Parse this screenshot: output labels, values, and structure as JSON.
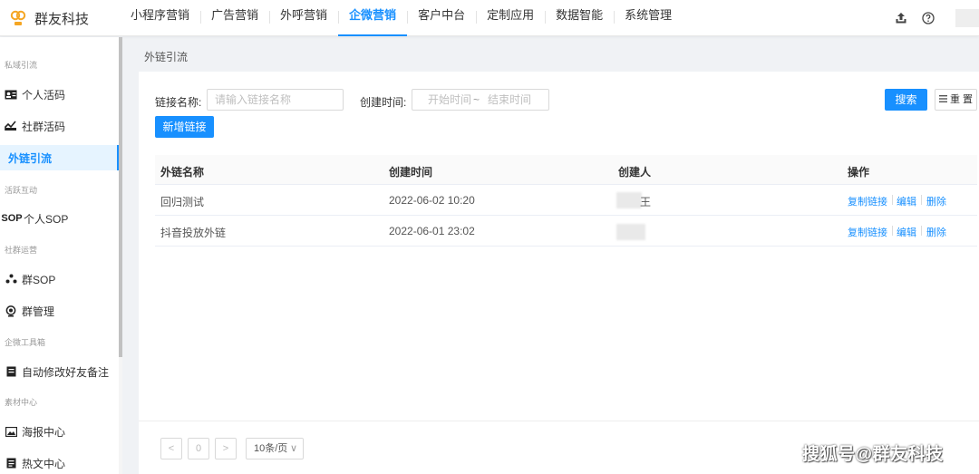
{
  "app": {
    "logo_text": "群友科技"
  },
  "nav": {
    "items": [
      "小程序营销",
      "广告营销",
      "外呼营销",
      "企微营销",
      "客户中台",
      "定制应用",
      "数据智能",
      "系统管理"
    ],
    "active_index": 3
  },
  "sidebar": {
    "groups": [
      "私域引流",
      "活跃互动",
      "社群运营",
      "企微工具箱",
      "素材中心"
    ],
    "items": [
      "个人活码",
      "社群活码",
      "外链引流",
      "个人SOP",
      "群SOP",
      "群管理",
      "自动修改好友备注",
      "海报中心",
      "热文中心"
    ],
    "active_index": 2
  },
  "breadcrumb": "外链引流",
  "search": {
    "name_label": "链接名称:",
    "name_placeholder": "请输入链接名称",
    "time_label": "创建时间:",
    "start_placeholder": "开始时间",
    "sep": "~",
    "end_placeholder": "结束时间",
    "search_btn": "搜索",
    "reset_btn": "重 置",
    "add_btn": "新增链接"
  },
  "table": {
    "columns": [
      "外链名称",
      "创建时间",
      "创建人",
      "操作"
    ],
    "rows": [
      {
        "name": "回归测试",
        "time": "2022-06-02 10:20",
        "creator": "王"
      },
      {
        "name": "抖音投放外链",
        "time": "2022-06-01 23:02",
        "creator": ""
      }
    ],
    "actions": [
      "复制链接",
      "编辑",
      "删除"
    ]
  },
  "pagination": {
    "prev": "<",
    "page": "0",
    "next": ">",
    "page_size": "10条/页"
  },
  "watermark": "搜狐号@群友科技",
  "colors": {
    "primary": "#1890ff"
  }
}
